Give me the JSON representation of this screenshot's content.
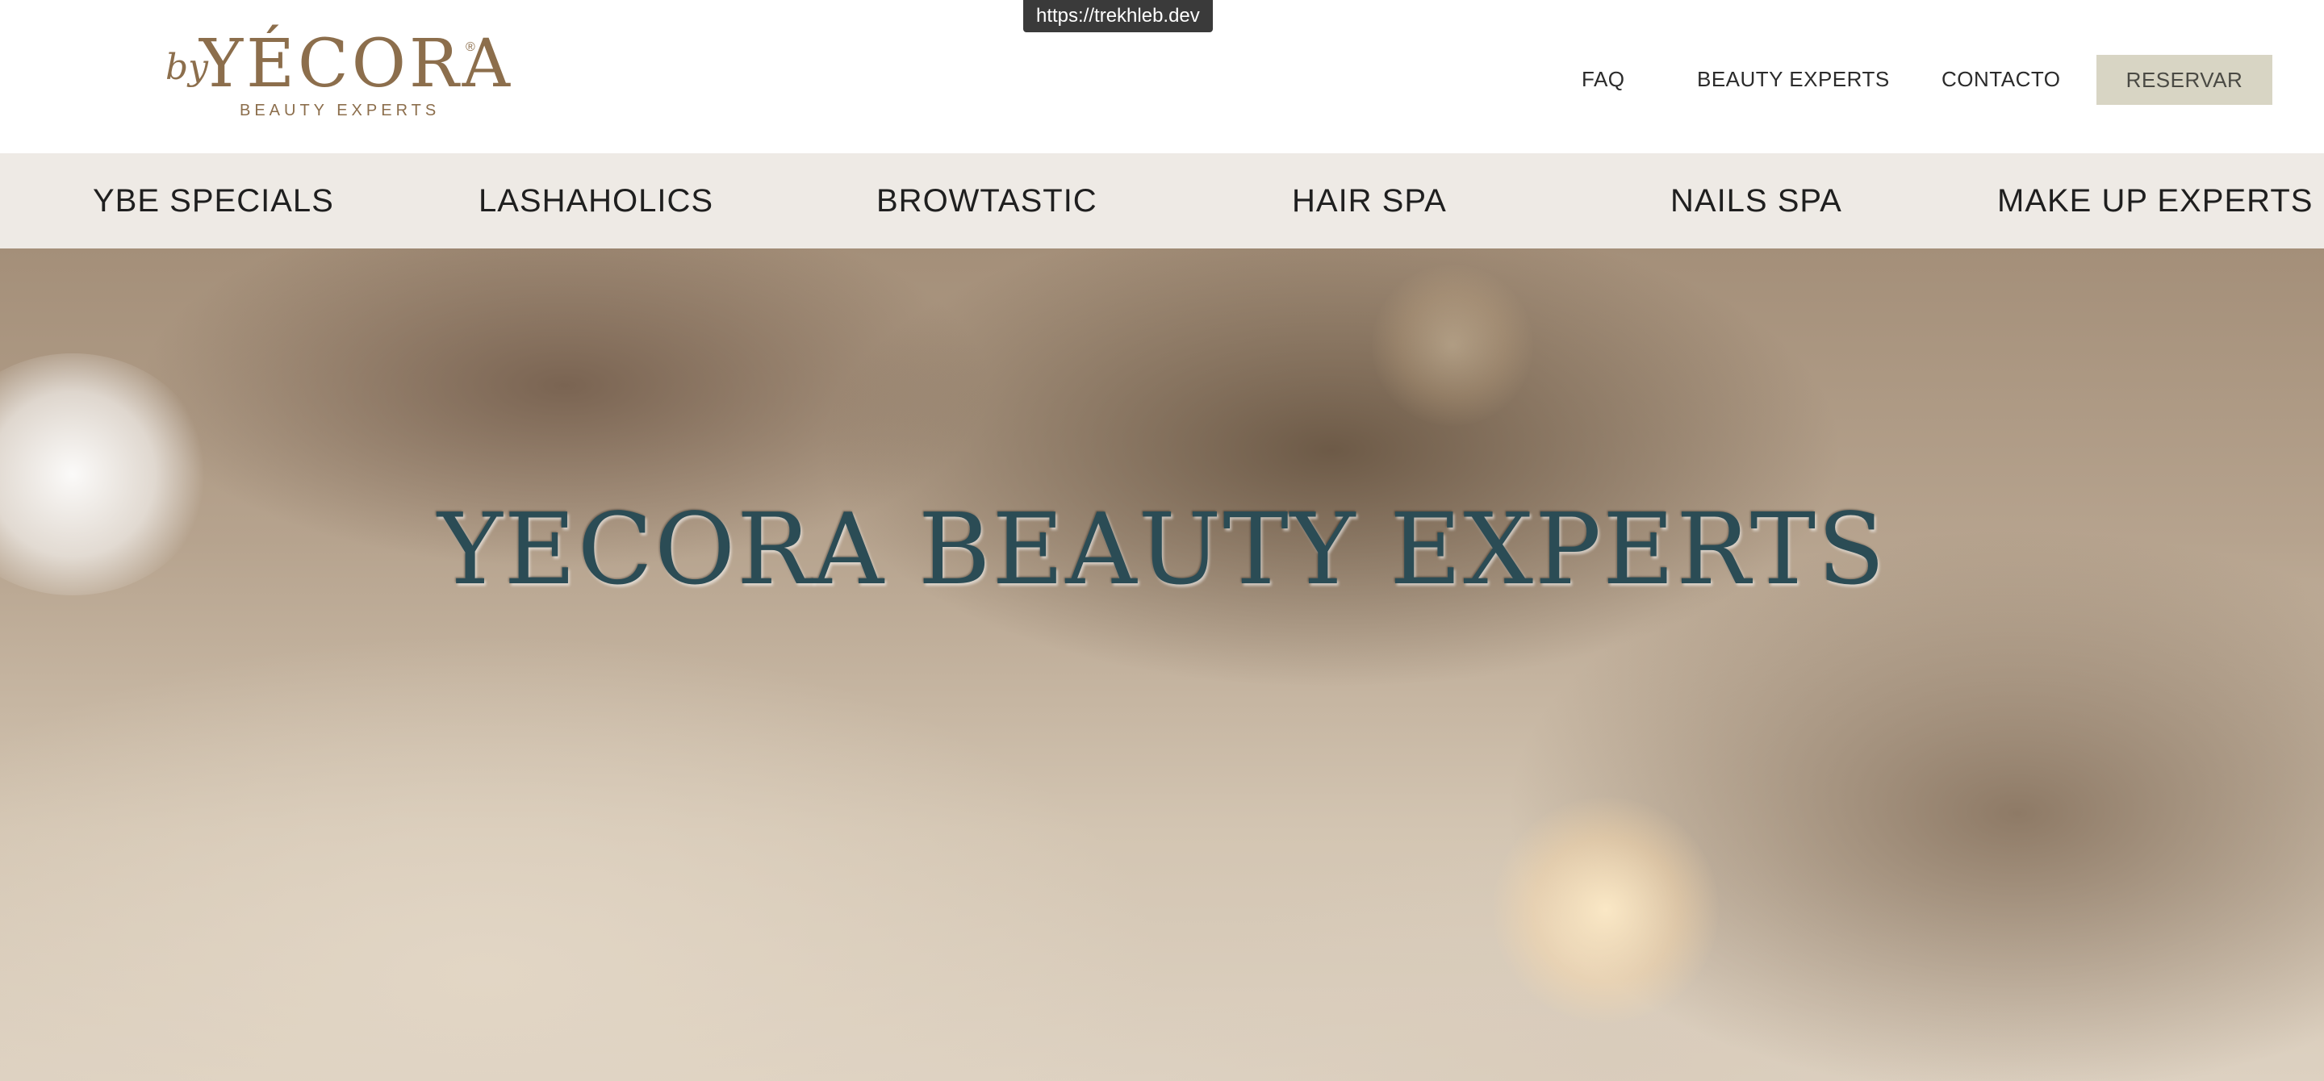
{
  "browser": {
    "link_preview": "https://trekhleb.dev"
  },
  "header": {
    "logo": {
      "prefix": "by",
      "name": "YÉCORA",
      "registered": "®",
      "tagline": "BEAUTY EXPERTS"
    },
    "nav": [
      {
        "label": "FAQ"
      },
      {
        "label": "BEAUTY EXPERTS"
      },
      {
        "label": "CONTACTO"
      }
    ],
    "cta_label": "RESERVAR"
  },
  "categories": [
    {
      "label": "YBE SPECIALS"
    },
    {
      "label": "LASHAHOLICS"
    },
    {
      "label": "BROWTASTIC"
    },
    {
      "label": "HAIR SPA"
    },
    {
      "label": "NAILS SPA"
    },
    {
      "label": "MAKE UP EXPERTS"
    }
  ],
  "hero": {
    "title": "YECORA BEAUTY EXPERTS",
    "background_image": "blurred-self-care-sanctuary-mirror-photo"
  },
  "colors": {
    "brand_gold": "#8c6e4c",
    "cta_background": "#d8d5c4",
    "category_bar": "#eeeae5",
    "hero_title": "#2b4c55"
  }
}
